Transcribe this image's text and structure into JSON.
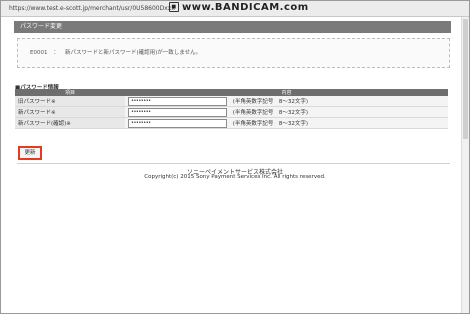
{
  "window": {
    "url": "https://www.test.e-scott.jp/merchant/usr/0U58600Dxxx",
    "recorder_watermark": "www.BANDICAM.com",
    "watermark_icon_glyph": "■"
  },
  "section": {
    "title": "パスワード変更"
  },
  "error": {
    "code": "E0001",
    "separator": "：",
    "message": "新パスワードと新パスワード(確認用)が一致しません。"
  },
  "form": {
    "title": "■パスワード情報",
    "columns": [
      "項目",
      "内容"
    ],
    "rows": [
      {
        "label": "旧パスワード※",
        "value": "••••••••",
        "hint": "(半角英数字記号　8〜32文字)"
      },
      {
        "label": "新パスワード※",
        "value": "••••••••",
        "hint": "(半角英数字記号　8〜32文字)"
      },
      {
        "label": "新パスワード(確認)※",
        "value": "••••••••",
        "hint": "(半角英数字記号　8〜32文字)"
      }
    ],
    "submit_label": "更新"
  },
  "footer": {
    "company": "ソニーペイメントサービス株式会社",
    "copyright": "Copyright(c) 2015 Sony Payment Services Inc. All rights reserved."
  }
}
